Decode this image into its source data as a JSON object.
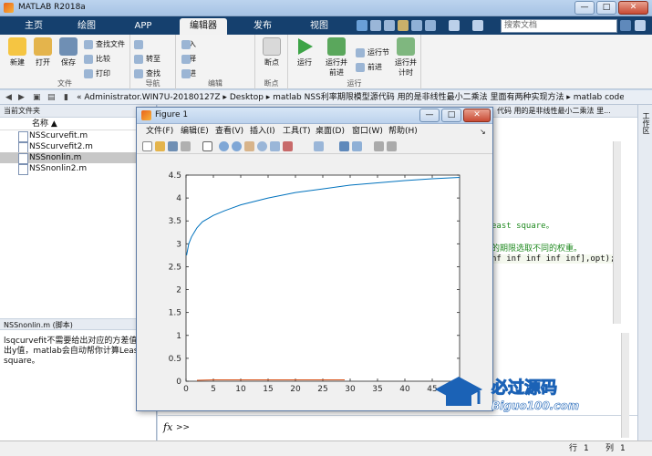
{
  "window": {
    "title": "MATLAB R2018a",
    "min": "—",
    "max": "□",
    "close": "✕"
  },
  "tabs": [
    {
      "label": "主页"
    },
    {
      "label": "绘图"
    },
    {
      "label": "APP"
    },
    {
      "label": "编辑器",
      "active": true
    },
    {
      "label": "发布"
    },
    {
      "label": "视图"
    }
  ],
  "search": {
    "placeholder": "搜索文档"
  },
  "ribbon": {
    "file_group": {
      "new": "新建",
      "open": "打开",
      "save": "保存",
      "find_files": "查找文件",
      "compare": "比较",
      "print": "打印",
      "label": "文件"
    },
    "nav_group": {
      "goto": "转至",
      "find": "查找",
      "label": "导航"
    },
    "edit_group": {
      "insert": "插入",
      "comment": "注释",
      "indent": "缩进",
      "label": "编辑"
    },
    "bp_group": {
      "breakpoint": "断点",
      "label": "断点"
    },
    "run_group": {
      "run": "运行",
      "run_advance": "运行并\n前进",
      "run_section": "运行节",
      "advance": "前进",
      "run_time": "运行并\n计时",
      "label": "运行"
    }
  },
  "addressbar": {
    "path": "« Administrator.WIN7U-20180127Z ▸ Desktop ▸ matlab NSS利率期限模型源代码 用的是非线性最小二乘法 里面有两种实现方法 ▸ matlab code"
  },
  "leftpanel": {
    "header": "当前文件夹",
    "column": "名称 ▲",
    "files": [
      "NSScurvefit.m",
      "NSScurvefit2.m",
      "NSSnonlin.m",
      "NSSnonlin2.m"
    ],
    "selected": 2,
    "detail_header": "NSSnonlin.m  (脚本)",
    "detail_text": "lsqcurvefit不需要给出对应的方差值，给出y值，matlab会自动帮你计算Least square。"
  },
  "editor": {
    "tab_path": "代码 用的是非线性最小二乘法 里...",
    "line1": "east square。",
    "line2": "的期限选取不同的权重。",
    "line3": "nf inf inf inf inf],opt);",
    "cmd_prompt": ">>",
    "fx": "fx"
  },
  "rightstrip": {
    "label": "工作区"
  },
  "status": {
    "row_label": "行",
    "row": "1",
    "col_label": "列",
    "col": "1"
  },
  "figure": {
    "title": "Figure 1",
    "menu": [
      "文件(F)",
      "编辑(E)",
      "查看(V)",
      "插入(I)",
      "工具(T)",
      "桌面(D)",
      "窗口(W)",
      "帮助(H)"
    ]
  },
  "chart_data": {
    "type": "line",
    "title": "",
    "xlabel": "",
    "ylabel": "",
    "xlim": [
      0,
      50
    ],
    "ylim": [
      0,
      4.5
    ],
    "xticks": [
      0,
      5,
      10,
      15,
      20,
      25,
      30,
      35,
      40,
      45
    ],
    "yticks": [
      0,
      0.5,
      1,
      1.5,
      2,
      2.5,
      3,
      3.5,
      4,
      4.5
    ],
    "grid": false,
    "series": [
      {
        "color": "#0072bd",
        "x": [
          0.1,
          0.5,
          1,
          2,
          3,
          5,
          7,
          10,
          15,
          20,
          25,
          30,
          35,
          40,
          45,
          50
        ],
        "y": [
          2.75,
          3.0,
          3.15,
          3.35,
          3.48,
          3.62,
          3.72,
          3.85,
          4.0,
          4.12,
          4.2,
          4.28,
          4.33,
          4.38,
          4.42,
          4.45
        ]
      },
      {
        "color": "#d95319",
        "x": [
          2,
          5,
          10,
          15,
          20,
          25,
          29
        ],
        "y": [
          0.02,
          0.03,
          0.03,
          0.03,
          0.03,
          0.03,
          0.03
        ]
      }
    ]
  },
  "watermark": {
    "text": "必过源码",
    "url": "Biguo100.com"
  }
}
